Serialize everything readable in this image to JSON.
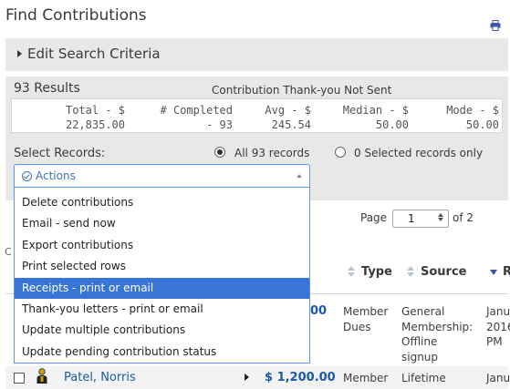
{
  "page": {
    "title": "Find Contributions",
    "print_icon": "print-icon"
  },
  "search": {
    "label": "Edit Search Criteria"
  },
  "results": {
    "count": "93 Results",
    "status": "Contribution Thank-you Not Sent",
    "stats": [
      {
        "label": "Total - $",
        "value": "22,835.00"
      },
      {
        "label": "# Completed",
        "value": "- 93"
      },
      {
        "label": "Avg - $",
        "value": "245.54"
      },
      {
        "label": "Median - $",
        "value": "50.00"
      },
      {
        "label": "Mode - $",
        "value": "50.00"
      }
    ],
    "select_label": "Select Records:",
    "radio_all": "All 93 records",
    "radio_selected": "0 Selected records only"
  },
  "actions": {
    "label": "Actions",
    "selected_index": 4,
    "items": [
      "Delete contributions",
      "Email - send now",
      "Export contributions",
      "Print selected rows",
      "Receipts - print or email",
      "Thank-you letters - print or email",
      "Update multiple contributions",
      "Update pending contribution status"
    ]
  },
  "pager": {
    "prefix": "Page",
    "value": "1",
    "suffix": "of 2"
  },
  "table": {
    "headers": {
      "type": "Type",
      "source": "Source",
      "received": "R"
    },
    "left_stub": "C",
    "rows": [
      {
        "amount": "00",
        "type": [
          "Member",
          "Dues"
        ],
        "source": [
          "General",
          "Membership:",
          "Offline",
          "signup"
        ],
        "date": [
          "Janu",
          "2016",
          "PM"
        ]
      },
      {
        "name": "Patel, Norris",
        "amount": "$ 1,200.00",
        "type": [
          "Member"
        ],
        "source": [
          "Lifetime"
        ],
        "date": [
          "Janu"
        ]
      }
    ]
  },
  "colors": {
    "accent": "#3875d7",
    "link": "#1a5aa6",
    "panel": "#e8e8e8"
  }
}
